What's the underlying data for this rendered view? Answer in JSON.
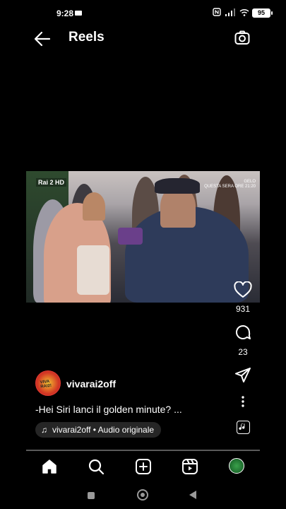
{
  "status_bar": {
    "time": "9:28",
    "battery": "95"
  },
  "header": {
    "title": "Reels"
  },
  "video": {
    "channel_logo": "Rai 2 HD",
    "overlay_line1": "GELO",
    "overlay_line2": "QUESTA SERA ORE 21:20"
  },
  "actions": {
    "likes": "931",
    "comments": "23"
  },
  "post": {
    "username": "vivarai2off",
    "avatar_text": "VIVA RAI2!",
    "caption": "-Hei Siri lanci il golden minute? ...",
    "audio": "vivarai2off • Audio originale"
  },
  "progress": {
    "fraction": 0.0
  },
  "bottom_nav": [
    "home-icon",
    "search-icon",
    "create-icon",
    "reels-icon",
    "profile-avatar"
  ],
  "colors": {
    "background": "#000000",
    "pill": "#262626",
    "progress_track": "#5a5a5a"
  }
}
